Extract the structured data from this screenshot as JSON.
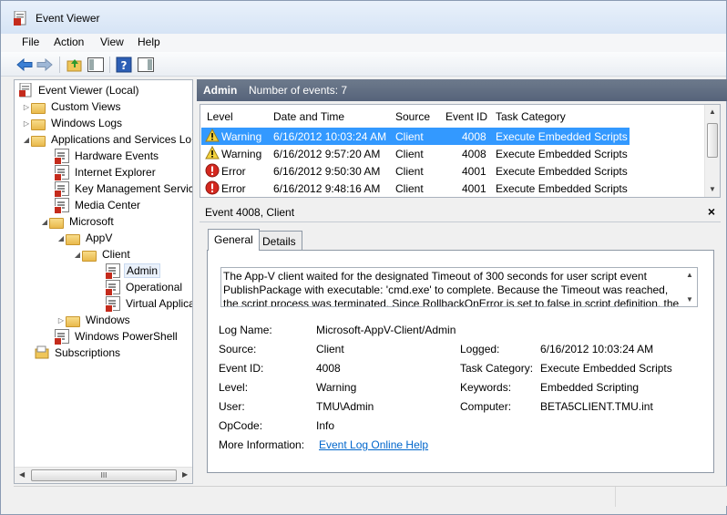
{
  "window": {
    "title": "Event Viewer"
  },
  "menu": [
    "File",
    "Action",
    "View",
    "Help"
  ],
  "toolbar": {
    "icons": [
      "back-icon",
      "forward-icon",
      "up-folder-icon",
      "show-hide-tree-icon",
      "help-icon",
      "show-hide-action-pane-icon"
    ]
  },
  "tree": {
    "items": [
      {
        "label": "Event Viewer (Local)",
        "icon": "event-viewer-icon",
        "expander": ""
      },
      {
        "label": "Custom Views",
        "icon": "folder-icon",
        "expander": "collapsed"
      },
      {
        "label": "Windows Logs",
        "icon": "folder-icon",
        "expander": "collapsed"
      },
      {
        "label": "Applications and Services Lo",
        "icon": "folder-icon",
        "expander": "expanded"
      },
      {
        "label": "Hardware Events",
        "icon": "log-icon",
        "expander": ""
      },
      {
        "label": "Internet Explorer",
        "icon": "log-icon",
        "expander": ""
      },
      {
        "label": "Key Management Service",
        "icon": "log-icon",
        "expander": ""
      },
      {
        "label": "Media Center",
        "icon": "log-icon",
        "expander": ""
      },
      {
        "label": "Microsoft",
        "icon": "folder-icon",
        "expander": "expanded"
      },
      {
        "label": "AppV",
        "icon": "folder-icon",
        "expander": "expanded"
      },
      {
        "label": "Client",
        "icon": "folder-icon",
        "expander": "expanded"
      },
      {
        "label": "Admin",
        "icon": "log-icon",
        "expander": "",
        "selected": true
      },
      {
        "label": "Operational",
        "icon": "log-icon",
        "expander": ""
      },
      {
        "label": "Virtual Applica",
        "icon": "log-icon",
        "expander": ""
      },
      {
        "label": "Windows",
        "icon": "folder-icon",
        "expander": "collapsed"
      },
      {
        "label": "Windows PowerShell",
        "icon": "log-icon",
        "expander": ""
      },
      {
        "label": "Subscriptions",
        "icon": "subscriptions-icon",
        "expander": ""
      }
    ],
    "hscroll_grip": "III"
  },
  "header": {
    "log_name": "Admin",
    "count_text": "Number of events: 7"
  },
  "events": {
    "columns": [
      "Level",
      "Date and Time",
      "Source",
      "Event ID",
      "Task Category"
    ],
    "rows": [
      {
        "level": "Warning",
        "icon": "warning-icon",
        "datetime": "6/16/2012 10:03:24 AM",
        "source": "Client",
        "event_id": "4008",
        "task": "Execute Embedded Scripts",
        "selected": true
      },
      {
        "level": "Warning",
        "icon": "warning-icon",
        "datetime": "6/16/2012 9:57:20 AM",
        "source": "Client",
        "event_id": "4008",
        "task": "Execute Embedded Scripts"
      },
      {
        "level": "Error",
        "icon": "error-icon",
        "datetime": "6/16/2012 9:50:30 AM",
        "source": "Client",
        "event_id": "4001",
        "task": "Execute Embedded Scripts"
      },
      {
        "level": "Error",
        "icon": "error-icon",
        "datetime": "6/16/2012 9:48:16 AM",
        "source": "Client",
        "event_id": "4001",
        "task": "Execute Embedded Scripts"
      }
    ]
  },
  "detail": {
    "title": "Event 4008, Client",
    "close": "×",
    "tabs": [
      "General",
      "Details"
    ],
    "description": "The App-V client waited for the designated Timeout of 300 seconds for user script event PublishPackage with executable: 'cmd.exe' to complete. Because the Timeout was reached, the script process was terminated. Since RollbackOnError is set to false in script definition, the",
    "labels": {
      "log_name": "Log Name:",
      "source": "Source:",
      "event_id": "Event ID:",
      "level": "Level:",
      "user": "User:",
      "opcode": "OpCode:",
      "more_info": "More Information:",
      "logged": "Logged:",
      "task_category": "Task Category:",
      "keywords": "Keywords:",
      "computer": "Computer:"
    },
    "values": {
      "log_name": "Microsoft-AppV-Client/Admin",
      "source": "Client",
      "event_id": "4008",
      "level": "Warning",
      "user": "TMU\\Admin",
      "opcode": "Info",
      "more_info": "Event Log Online Help",
      "logged": "6/16/2012 10:03:24 AM",
      "task_category": "Execute Embedded Scripts",
      "keywords": "Embedded Scripting",
      "computer": "BETA5CLIENT.TMU.int"
    }
  },
  "colors": {
    "selection": "#3399ff",
    "header_bg": "#5f6c80",
    "link": "#0066cc"
  }
}
